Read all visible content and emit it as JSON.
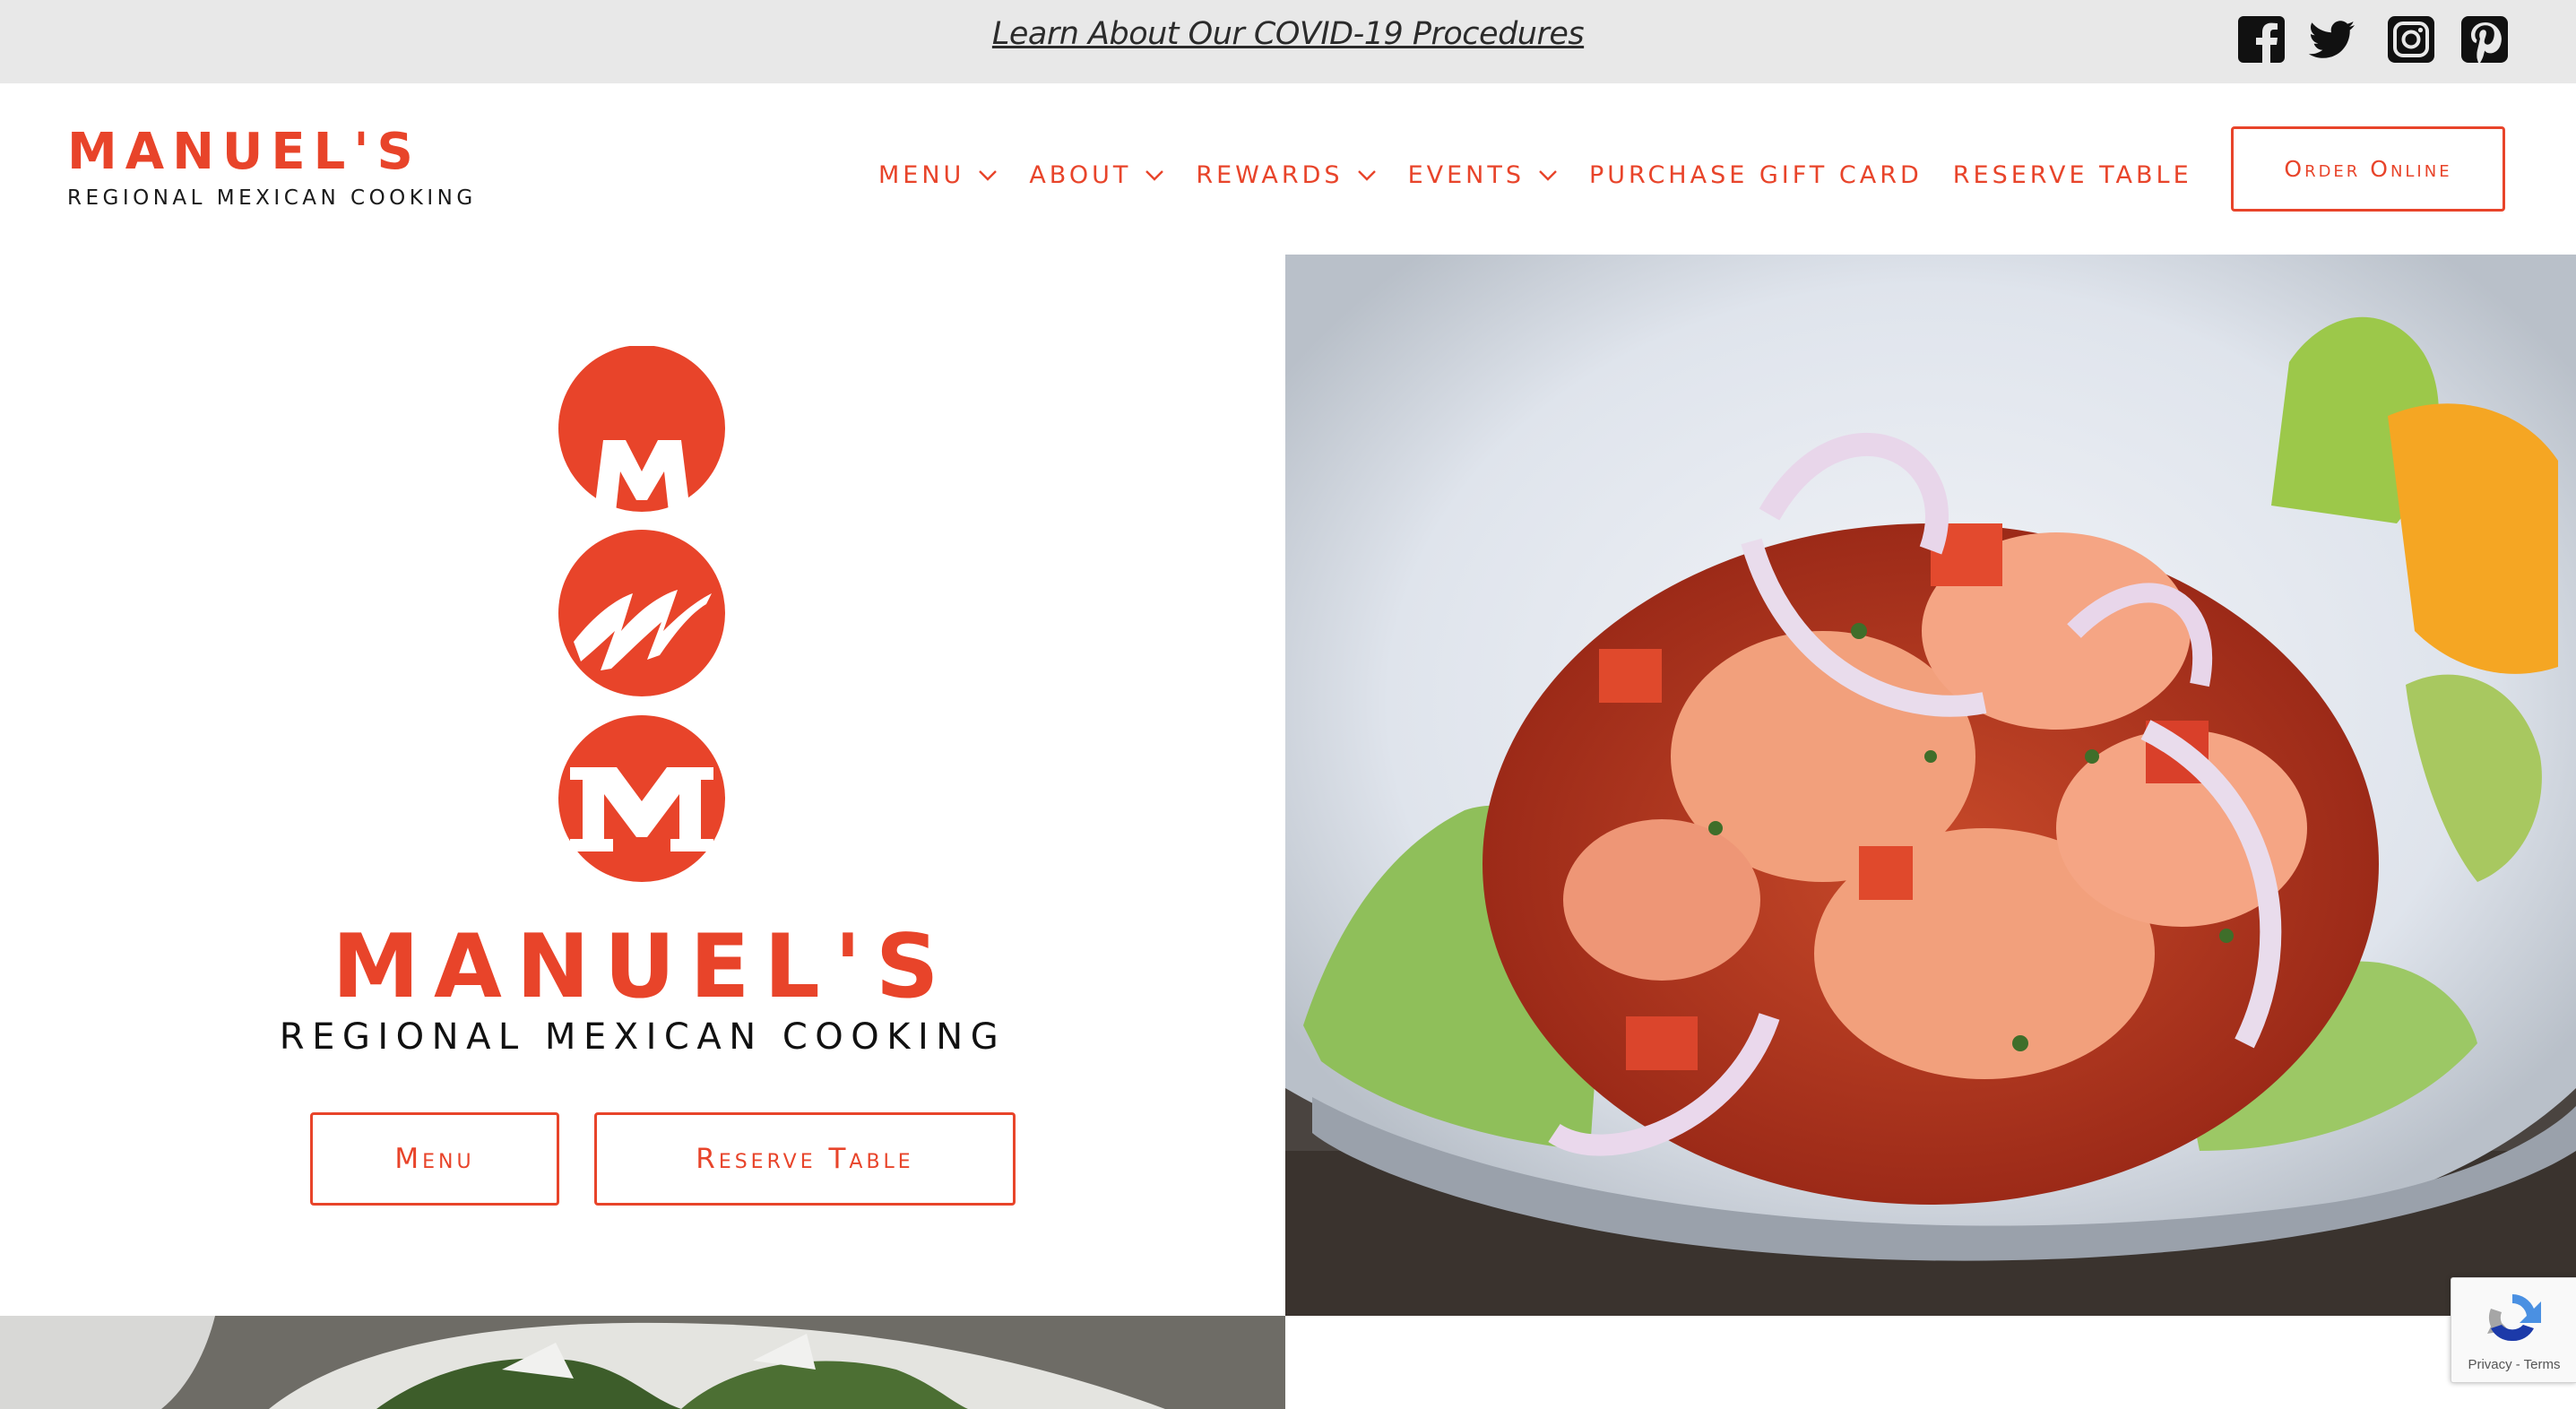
{
  "topbar": {
    "covid_link": "Learn About Our COVID-19 Procedures",
    "social": [
      "facebook-icon",
      "twitter-icon",
      "instagram-icon",
      "pinterest-icon"
    ]
  },
  "header": {
    "brand_name": "MANUEL'S",
    "brand_sub": "REGIONAL MEXICAN COOKING",
    "nav": [
      {
        "label": "MENU",
        "dropdown": true
      },
      {
        "label": "ABOUT",
        "dropdown": true
      },
      {
        "label": "REWARDS",
        "dropdown": true
      },
      {
        "label": "EVENTS",
        "dropdown": true
      },
      {
        "label": "PURCHASE GIFT CARD",
        "dropdown": false
      },
      {
        "label": "RESERVE TABLE",
        "dropdown": false
      }
    ],
    "order_online": "Order Online"
  },
  "hero": {
    "brand_name": "MANUEL'S",
    "brand_sub": "REGIONAL MEXICAN COOKING",
    "menu_button": "Menu",
    "reserve_button": "Reserve Table",
    "image": "shrimp-ceviche-photo"
  },
  "recaptcha": {
    "text": "Privacy - Terms"
  },
  "colors": {
    "accent": "#e8442a",
    "topbar_bg": "#e8e8e8",
    "text_dark": "#1a1a1a"
  }
}
